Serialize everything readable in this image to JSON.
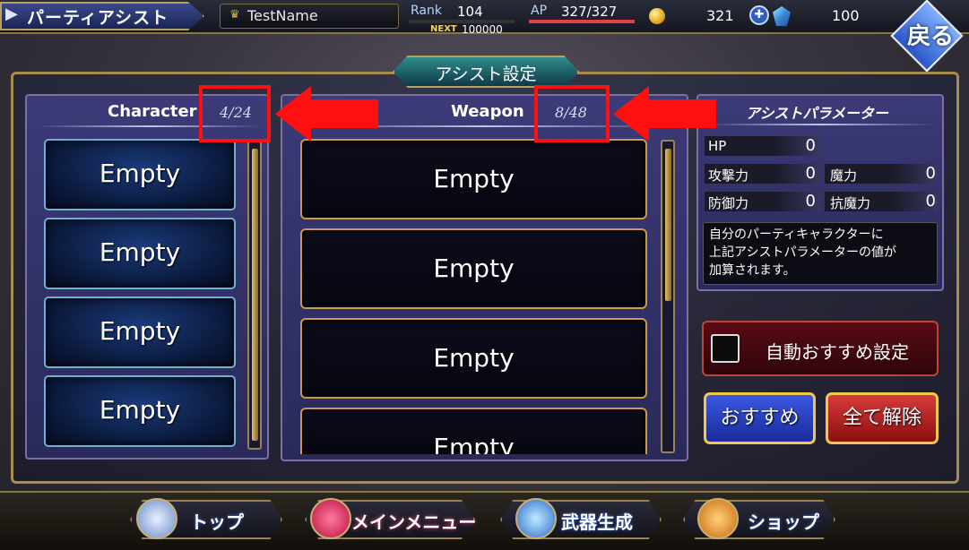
{
  "header": {
    "title": "パーティアシスト",
    "player_name": "TestName",
    "rank_label": "Rank",
    "rank_value": "104",
    "next_label": "NEXT",
    "next_value": "100000",
    "ap_label": "AP",
    "ap_value": "327/327",
    "ap_fraction": 1.0,
    "coins": "321",
    "gems": "100",
    "back_label": "戻る"
  },
  "assist_tab": "アシスト設定",
  "character_panel": {
    "title": "Character",
    "count": "4/24",
    "slots": [
      "Empty",
      "Empty",
      "Empty",
      "Empty"
    ]
  },
  "weapon_panel": {
    "title": "Weapon",
    "count": "8/48",
    "slots": [
      "Empty",
      "Empty",
      "Empty",
      "Empty"
    ]
  },
  "param_panel": {
    "title": "アシストパラメーター",
    "hp_label": "HP",
    "hp_value": "0",
    "atk_label": "攻撃力",
    "atk_value": "0",
    "mag_label": "魔力",
    "mag_value": "0",
    "def_label": "防御力",
    "def_value": "0",
    "res_label": "抗魔力",
    "res_value": "0",
    "desc_lines": [
      "自分のパーティキャラクターに",
      "上記アシストパラメーターの値が",
      "加算されます。"
    ]
  },
  "buttons": {
    "auto_recommend": "自動おすすめ設定",
    "recommend": "おすすめ",
    "clear_all": "全て解除"
  },
  "nav": {
    "top": "トップ",
    "main_menu": "メインメニュー",
    "weapon_craft": "武器生成",
    "shop": "ショップ"
  },
  "colors": {
    "annotation_red": "#ff1010",
    "frame_gold": "#a88c4e",
    "panel_purple": "#3c3a78"
  }
}
